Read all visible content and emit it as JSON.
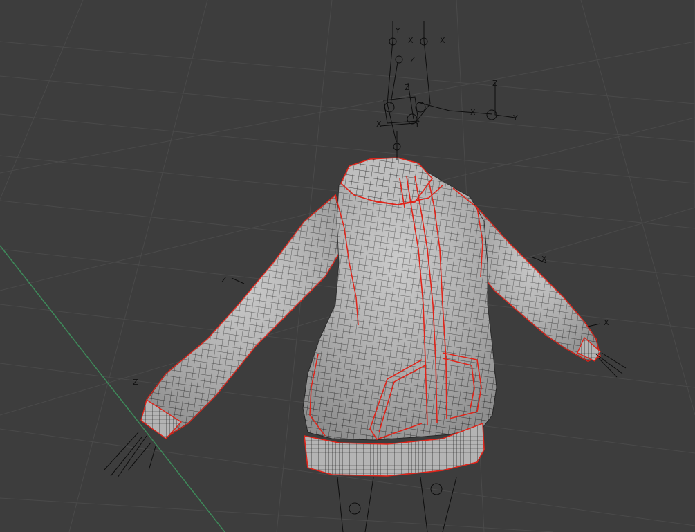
{
  "viewport": {
    "mode": "3d-edit-mode",
    "colors": {
      "background": "#3d3d3d",
      "grid_line": "#4a4a4a",
      "y_axis_line": "#3e8a5a",
      "mesh_fill": "#bdbdbd",
      "mesh_wire": "#1a1a1a",
      "seam": "#e0241a",
      "armature": "#0d0d0d"
    }
  },
  "gizmo_labels": {
    "head_y1": "Y",
    "head_x1": "X",
    "head_x2": "X",
    "head_z1": "Z",
    "neck_z": "Z",
    "neck_x": "X",
    "neck_y": "Y",
    "shoulder_z": "Z",
    "shoulder_x": "X",
    "shoulder_y": "Y",
    "right_arm_z": "Z",
    "right_hand_z": "Z",
    "left_arm_x": "X",
    "left_hand_x": "X"
  }
}
